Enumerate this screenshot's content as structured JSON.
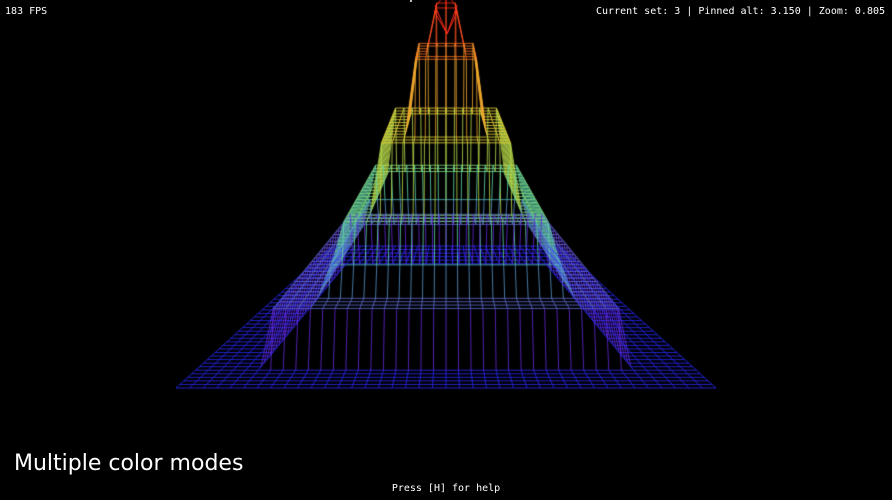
{
  "hud": {
    "fps": "183 FPS",
    "status": "Current set: 3 | Pinned alt: 3.150 | Zoom: 0.805",
    "help": "Press [H] for help"
  },
  "caption": "Multiple color modes",
  "scene": {
    "background": "#000000",
    "render_mode": "wireframe",
    "color_mode": "altitude rainbow",
    "colors": {
      "base": "#2a2aff",
      "violet": "#6a2ad8",
      "cyan": "#4fd6c8",
      "green": "#9adf5a",
      "yellow": "#f2e23a",
      "orange": "#f29a2a",
      "red": "#ff2a1a",
      "text": "#ffffff"
    }
  }
}
